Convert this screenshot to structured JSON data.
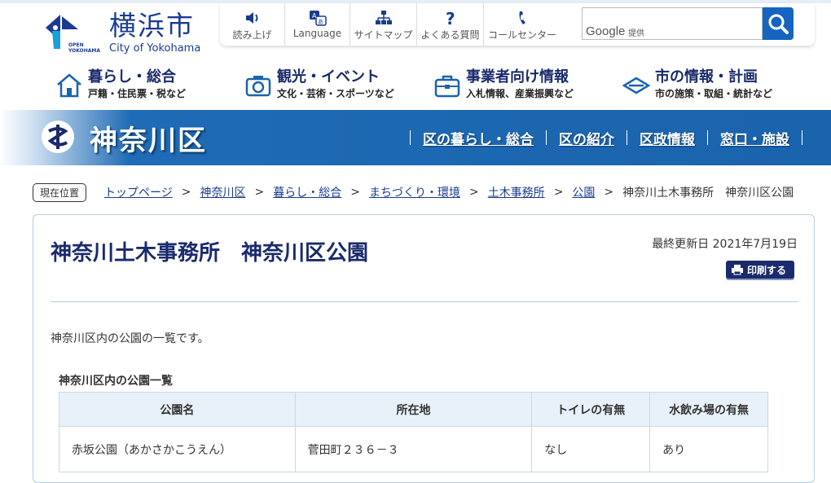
{
  "header": {
    "logo_kanji": "横浜市",
    "logo_en": "City of Yokohama",
    "logo_sub": "OPEN\nYOKOHAMA",
    "tools": [
      {
        "label": "読み上げ",
        "icon": "speaker-icon"
      },
      {
        "label": "Language",
        "icon": "language-icon"
      },
      {
        "label": "サイトマップ",
        "icon": "sitemap-icon"
      },
      {
        "label": "よくある質問",
        "icon": "question-icon"
      },
      {
        "label": "コールセンター",
        "icon": "phone-icon"
      }
    ],
    "search": {
      "brand": "Google",
      "provided": "提供",
      "value": ""
    }
  },
  "gnav": [
    {
      "title": "暮らし・総合",
      "sub": "戸籍・住民票・税など",
      "icon": "house-icon"
    },
    {
      "title": "観光・イベント",
      "sub": "文化・芸術・スポーツなど",
      "icon": "camera-icon"
    },
    {
      "title": "事業者向け情報",
      "sub": "入札情報、産業振興など",
      "icon": "briefcase-icon"
    },
    {
      "title": "市の情報・計画",
      "sub": "市の施策・取組・統計など",
      "icon": "city-emblem-icon"
    }
  ],
  "ward": {
    "name": "神奈川区",
    "links": [
      "区の暮らし・総合",
      "区の紹介",
      "区政情報",
      "窓口・施設"
    ]
  },
  "breadcrumb": {
    "here": "現在位置",
    "items": [
      "トップページ",
      "神奈川区",
      "暮らし・総合",
      "まちづくり・環境",
      "土木事務所",
      "公園"
    ],
    "current": "神奈川土木事務所　神奈川区公園",
    "separator": ">"
  },
  "page": {
    "title": "神奈川土木事務所　神奈川区公園",
    "updated": "最終更新日 2021年7月19日",
    "print": "印刷する",
    "intro": "神奈川区内の公園の一覧です。",
    "table_caption": "神奈川区内の公園一覧",
    "table": {
      "headers": [
        "公園名",
        "所在地",
        "トイレの有無",
        "水飲み場の有無"
      ],
      "rows": [
        [
          "赤坂公園（あかさかこうえん）",
          "菅田町２３６－３",
          "なし",
          "あり"
        ]
      ]
    }
  },
  "colors": {
    "brand": "#1a2a6c",
    "banner": "#1a63ad",
    "accent": "#1565c0"
  }
}
